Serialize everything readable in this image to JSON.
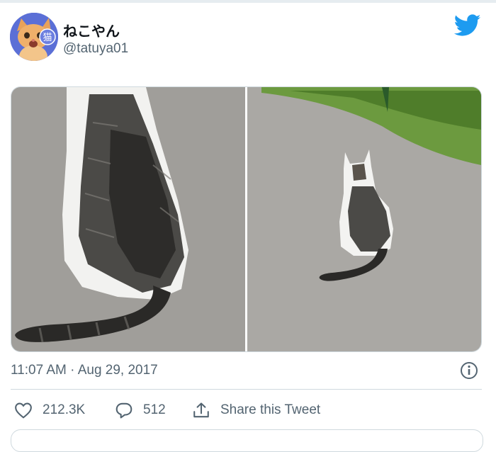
{
  "tweet": {
    "display_name": "ねこやん",
    "handle": "@tatuya01",
    "avatar_badge": "猫",
    "timestamp": "11:07 AM · Aug 29, 2017"
  },
  "media": {
    "left_photo": "cat-closeup-back",
    "right_photo": "cat-on-road-back"
  },
  "actions": {
    "likes": "212.3K",
    "replies": "512",
    "share_label": "Share this Tweet"
  },
  "colors": {
    "brand": "#1d9bf0",
    "text_secondary": "#536471",
    "avatar_bg": "#5b6fd6"
  }
}
